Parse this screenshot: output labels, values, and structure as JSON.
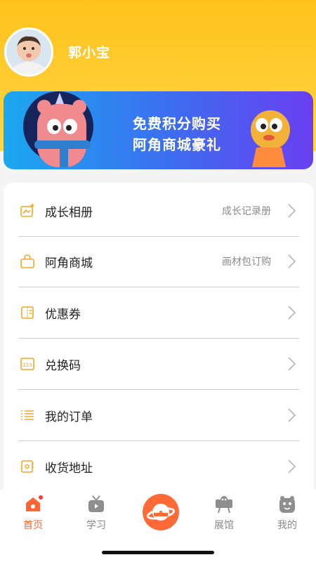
{
  "profile": {
    "name": "郭小宝"
  },
  "banner": {
    "line1": "免费积分购买",
    "line2": "阿角商城豪礼"
  },
  "menu": [
    {
      "label": "成长相册",
      "sub": "成长记录册",
      "icon": "photo-album-icon"
    },
    {
      "label": "阿角商城",
      "sub": "画材包订购",
      "icon": "shopping-bag-icon"
    },
    {
      "label": "优惠券",
      "sub": "",
      "icon": "coupon-icon"
    },
    {
      "label": "兑换码",
      "sub": "",
      "icon": "redeem-code-icon"
    },
    {
      "label": "我的订单",
      "sub": "",
      "icon": "order-list-icon"
    },
    {
      "label": "收货地址",
      "sub": "",
      "icon": "address-book-icon"
    }
  ],
  "tabs": [
    {
      "label": "首页",
      "icon": "home-icon",
      "active": true
    },
    {
      "label": "学习",
      "icon": "tv-icon",
      "active": false
    },
    {
      "label": "",
      "icon": "planet-icon",
      "active": false
    },
    {
      "label": "展馆",
      "icon": "gallery-icon",
      "active": false
    },
    {
      "label": "我的",
      "icon": "profile-icon",
      "active": false
    }
  ],
  "colors": {
    "header": "#ffc21c",
    "accent": "#ff6634",
    "icon": "#f5a623"
  }
}
